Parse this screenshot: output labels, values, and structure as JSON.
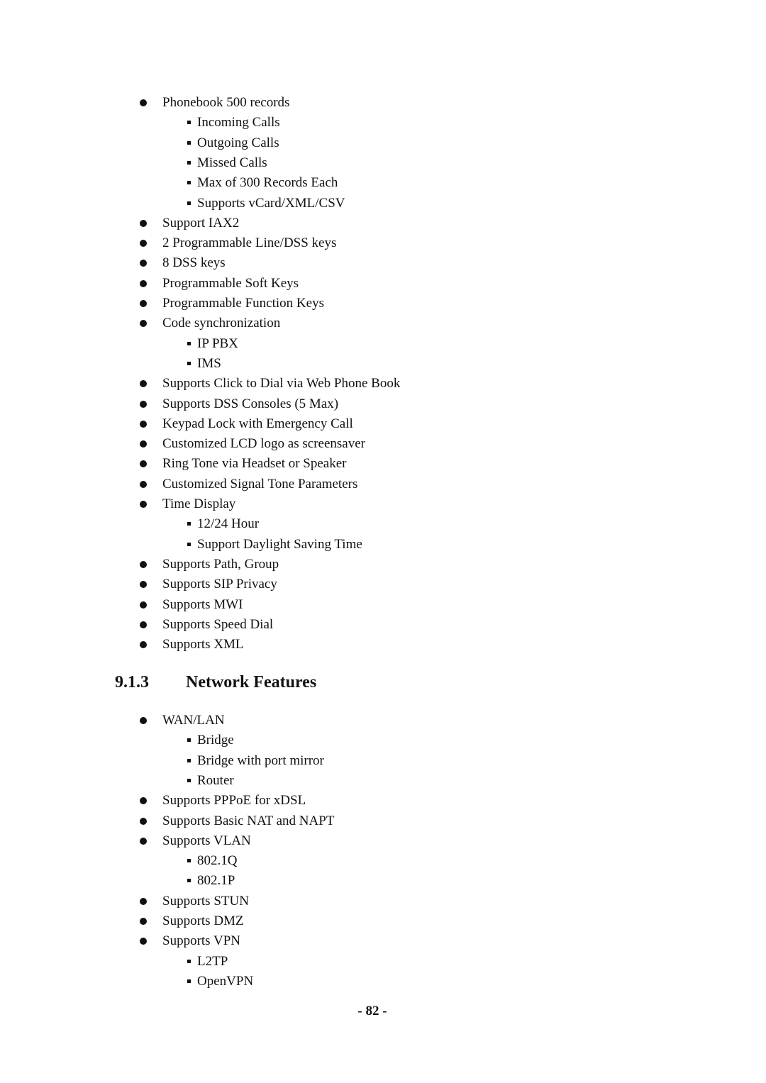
{
  "list1": [
    {
      "level": 1,
      "text": "Phonebook 500 records"
    },
    {
      "level": 2,
      "text": "Incoming Calls"
    },
    {
      "level": 2,
      "text": "Outgoing Calls"
    },
    {
      "level": 2,
      "text": "Missed Calls"
    },
    {
      "level": 2,
      "text": "Max of 300 Records Each"
    },
    {
      "level": 2,
      "text": "Supports vCard/XML/CSV"
    },
    {
      "level": 1,
      "text": "Support IAX2"
    },
    {
      "level": 1,
      "text": "2 Programmable Line/DSS keys"
    },
    {
      "level": 1,
      "text": "8 DSS keys"
    },
    {
      "level": 1,
      "text": "Programmable Soft Keys"
    },
    {
      "level": 1,
      "text": "Programmable Function Keys"
    },
    {
      "level": 1,
      "text": "Code synchronization"
    },
    {
      "level": 2,
      "text": "IP PBX"
    },
    {
      "level": 2,
      "text": "IMS"
    },
    {
      "level": 1,
      "text": "Supports Click to Dial via Web Phone Book"
    },
    {
      "level": 1,
      "text": "Supports DSS Consoles (5 Max)"
    },
    {
      "level": 1,
      "text": "Keypad Lock with Emergency Call"
    },
    {
      "level": 1,
      "text": "Customized LCD logo as screensaver"
    },
    {
      "level": 1,
      "text": "Ring Tone via Headset or Speaker"
    },
    {
      "level": 1,
      "text": "Customized Signal Tone Parameters"
    },
    {
      "level": 1,
      "text": "Time Display"
    },
    {
      "level": 2,
      "text": "12/24 Hour"
    },
    {
      "level": 2,
      "text": "Support Daylight Saving Time"
    },
    {
      "level": 1,
      "text": "Supports Path, Group"
    },
    {
      "level": 1,
      "text": "Supports SIP Privacy"
    },
    {
      "level": 1,
      "text": "Supports MWI"
    },
    {
      "level": 1,
      "text": "Supports Speed Dial"
    },
    {
      "level": 1,
      "text": "Supports XML"
    }
  ],
  "section": {
    "number": "9.1.3",
    "title": "Network Features"
  },
  "list2": [
    {
      "level": 1,
      "text": "WAN/LAN"
    },
    {
      "level": 2,
      "text": "Bridge"
    },
    {
      "level": 2,
      "text": "Bridge with port mirror"
    },
    {
      "level": 2,
      "text": "Router"
    },
    {
      "level": 1,
      "text": "Supports PPPoE for xDSL"
    },
    {
      "level": 1,
      "text": "Supports Basic NAT and NAPT"
    },
    {
      "level": 1,
      "text": "Supports VLAN"
    },
    {
      "level": 2,
      "text": "802.1Q"
    },
    {
      "level": 2,
      "text": "802.1P"
    },
    {
      "level": 1,
      "text": "Supports STUN"
    },
    {
      "level": 1,
      "text": "Supports DMZ"
    },
    {
      "level": 1,
      "text": "Supports VPN"
    },
    {
      "level": 2,
      "text": "L2TP"
    },
    {
      "level": 2,
      "text": "OpenVPN"
    }
  ],
  "page_number": "- 82 -"
}
